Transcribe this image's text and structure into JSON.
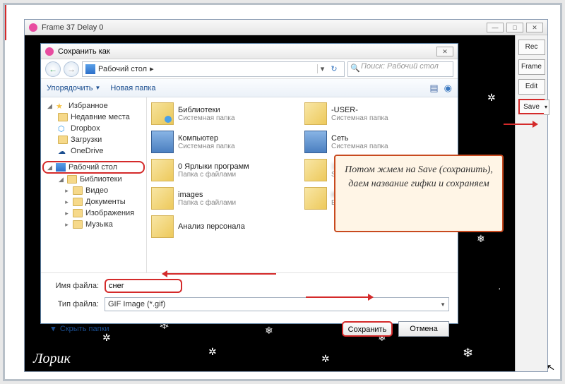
{
  "app": {
    "title": "Frame 37 Delay 0",
    "side_buttons": {
      "rec": "Rec",
      "frame": "Frame",
      "edit": "Edit",
      "save": "Save"
    }
  },
  "dialog": {
    "title": "Сохранить как",
    "breadcrumb": "Рабочий стол",
    "breadcrumb_sep": "▸",
    "search_placeholder": "Поиск: Рабочий стол",
    "organize": "Упорядочить",
    "new_folder": "Новая папка",
    "tree": {
      "favorites": "Избранное",
      "recent": "Недавние места",
      "dropbox": "Dropbox",
      "downloads": "Загрузки",
      "onedrive": "OneDrive",
      "desktop": "Рабочий стол",
      "libraries": "Библиотеки",
      "video": "Видео",
      "documents": "Документы",
      "pictures": "Изображения",
      "music": "Музыка"
    },
    "files": [
      {
        "name": "Библиотеки",
        "type": "Системная папка",
        "icon": "lib"
      },
      {
        "name": "-USER-",
        "type": "Системная папка",
        "icon": "user"
      },
      {
        "name": "Компьютер",
        "type": "Системная папка",
        "icon": "comp"
      },
      {
        "name": "Сеть",
        "type": "Системная папка",
        "icon": "net"
      },
      {
        "name": "0 Ярлыки программ",
        "type": "Папка с файлами",
        "icon": "fold"
      },
      {
        "name": "1",
        "type": "Student",
        "icon": "fold",
        "blur": true
      },
      {
        "name": "images",
        "type": "Папка с файлами",
        "icon": "fold"
      },
      {
        "name": "Имена",
        "type": "Бесплат",
        "icon": "fold",
        "blur": true
      },
      {
        "name": "Анализ персонала",
        "type": "",
        "icon": "fold"
      }
    ],
    "filename_label": "Имя файла:",
    "filename_value": "снег",
    "filetype_label": "Тип файла:",
    "filetype_value": "GIF Image (*.gif)",
    "hide_folders": "Скрыть папки",
    "save_btn": "Сохранить",
    "cancel_btn": "Отмена"
  },
  "callout": "Потом жмем на Save (сохранить), даем название гифки и сохраняем",
  "watermark": "Лорик"
}
